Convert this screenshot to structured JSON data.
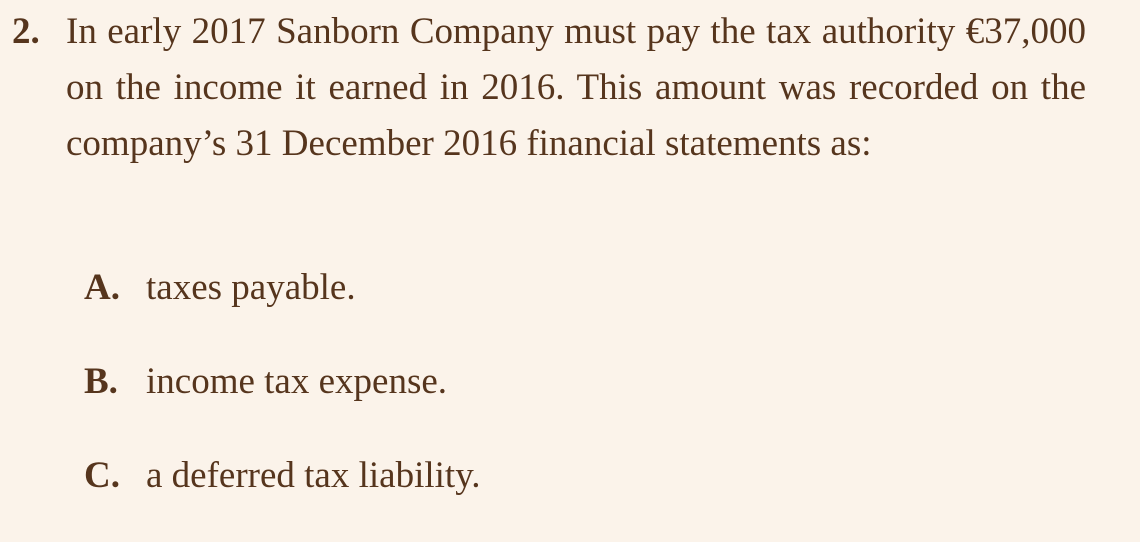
{
  "question": {
    "number": "2.",
    "text": "In early 2017 Sanborn Company must pay the tax authority €37,000 on the income it earned in 2016. This amount was recorded on the company’s 31 December 2016 financial statements as:"
  },
  "choices": [
    {
      "letter": "A.",
      "text": "taxes payable."
    },
    {
      "letter": "B.",
      "text": "income tax expense."
    },
    {
      "letter": "C.",
      "text": "a deferred tax liability."
    }
  ]
}
